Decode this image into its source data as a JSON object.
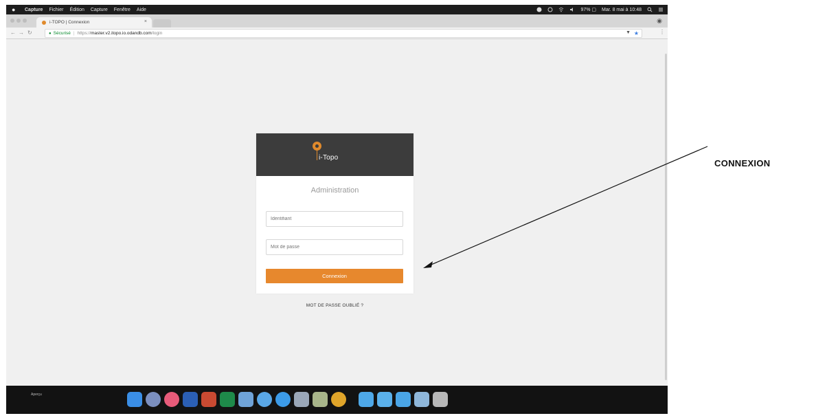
{
  "menubar": {
    "app": "Capture",
    "items": [
      "Fichier",
      "Édition",
      "Capture",
      "Fenêtre",
      "Aide"
    ],
    "battery": "97% ▢",
    "datetime": "Mar. 8 mai à 10:48"
  },
  "browser": {
    "tab_title": "i-TOPO | Connexion",
    "secure_label": "Sécurisé",
    "url_scheme": "https://",
    "url_host": "master.v2.itopo.io.odandb.com",
    "url_path": "/login"
  },
  "login": {
    "brand": "i-Topo",
    "title": "Administration",
    "username_placeholder": "Identifiant",
    "password_placeholder": "Mot de passe",
    "submit_label": "Connexion",
    "forgot_label": "MOT DE PASSE OUBLIÉ ?"
  },
  "dock": {
    "label": "Aperçu"
  },
  "annotation": {
    "label": "CONNEXION"
  },
  "colors": {
    "accent": "#e7882d",
    "card_header": "#3c3c3c",
    "page_bg": "#f0f0f0"
  }
}
